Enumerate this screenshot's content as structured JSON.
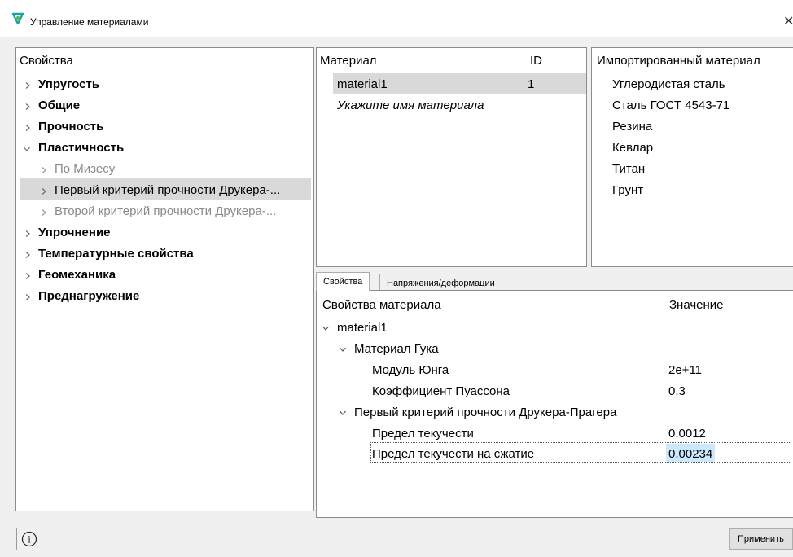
{
  "window": {
    "title": "Управление материалами",
    "close_glyph": "✕"
  },
  "tree": {
    "header": "Свойства",
    "items": [
      {
        "label": "Упругость",
        "state": "collapsed"
      },
      {
        "label": "Общие",
        "state": "collapsed"
      },
      {
        "label": "Прочность",
        "state": "collapsed"
      },
      {
        "label": "Пластичность",
        "state": "expanded"
      },
      {
        "label": "По Мизесу",
        "state": "collapsed"
      },
      {
        "label": "Первый критерий прочности Друкера-...",
        "state": "collapsed",
        "selected": true
      },
      {
        "label": "Второй критерий прочности Друкера-...",
        "state": "collapsed"
      },
      {
        "label": "Упрочнение",
        "state": "collapsed"
      },
      {
        "label": "Температурные свойства",
        "state": "collapsed"
      },
      {
        "label": "Геомеханика",
        "state": "collapsed"
      },
      {
        "label": "Преднагружение",
        "state": "collapsed"
      }
    ]
  },
  "materials": {
    "header_name": "Материал",
    "header_id": "ID",
    "rows": [
      {
        "name": "material1",
        "id": "1",
        "selected": true
      }
    ],
    "placeholder": "Укажите имя материала"
  },
  "imported": {
    "header": "Импортированный материал",
    "items": [
      "Углеродистая сталь",
      "Сталь ГОСТ 4543-71",
      "Резина",
      "Кевлар",
      "Титан",
      "Грунт"
    ]
  },
  "tabs": [
    {
      "label": "Свойства",
      "active": true
    },
    {
      "label": "Напряжения/деформации",
      "active": false
    }
  ],
  "props": {
    "header_name": "Свойства материала",
    "header_value": "Значение",
    "material": "material1",
    "groups": [
      {
        "label": "Материал Гука",
        "rows": [
          {
            "name": "Модуль Юнга",
            "value": "2e+11"
          },
          {
            "name": "Коэффициент Пуассона",
            "value": "0.3"
          }
        ]
      },
      {
        "label": "Первый критерий прочности Друкера-Прагера",
        "rows": [
          {
            "name": "Предел текучести",
            "value": "0.0012"
          },
          {
            "name": "Предел текучести на сжатие",
            "value": "0.00234"
          }
        ]
      }
    ]
  },
  "buttons": {
    "apply": "Применить",
    "info_glyph": "i"
  },
  "colors": {
    "selection": "#d9d9d9",
    "edit_highlight": "#cce8ff",
    "border": "#8c8c8c",
    "app_icon_teal": "#1aa3a3",
    "app_icon_green": "#5cb85c"
  },
  "icons": {
    "app": "app-logo-icon",
    "expand": "chevron-right-icon",
    "collapse": "chevron-down-icon",
    "info": "info-icon",
    "close": "close-icon"
  }
}
